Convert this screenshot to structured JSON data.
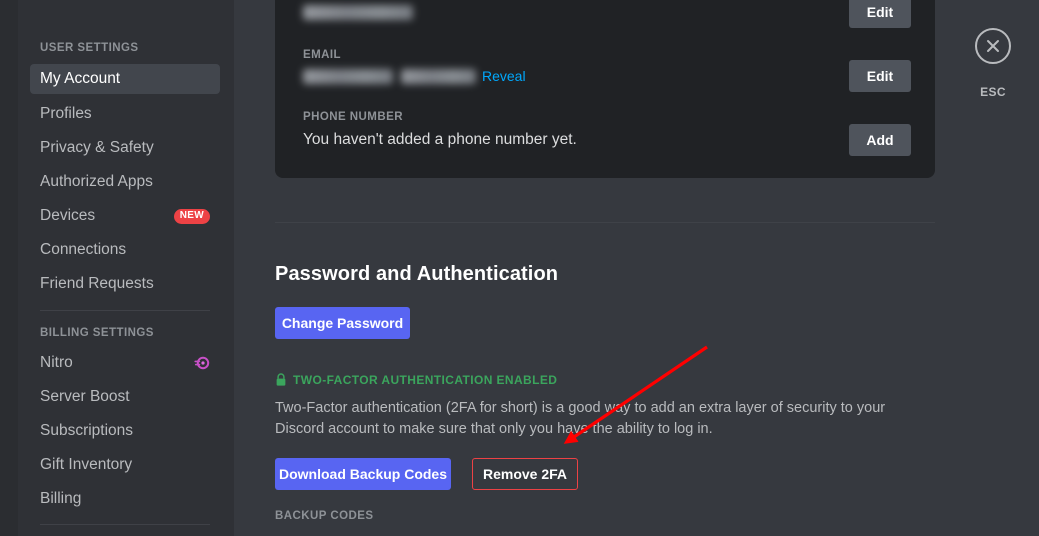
{
  "sidebar": {
    "groups": [
      {
        "header": "USER SETTINGS",
        "items": [
          {
            "label": "My Account",
            "selected": true,
            "badge": "",
            "icon": ""
          },
          {
            "label": "Profiles",
            "selected": false,
            "badge": "",
            "icon": ""
          },
          {
            "label": "Privacy & Safety",
            "selected": false,
            "badge": "",
            "icon": ""
          },
          {
            "label": "Authorized Apps",
            "selected": false,
            "badge": "",
            "icon": ""
          },
          {
            "label": "Devices",
            "selected": false,
            "badge": "NEW",
            "icon": ""
          },
          {
            "label": "Connections",
            "selected": false,
            "badge": "",
            "icon": ""
          },
          {
            "label": "Friend Requests",
            "selected": false,
            "badge": "",
            "icon": ""
          }
        ]
      },
      {
        "header": "BILLING SETTINGS",
        "items": [
          {
            "label": "Nitro",
            "selected": false,
            "badge": "",
            "icon": "nitro-wheel-icon"
          },
          {
            "label": "Server Boost",
            "selected": false,
            "badge": "",
            "icon": ""
          },
          {
            "label": "Subscriptions",
            "selected": false,
            "badge": "",
            "icon": ""
          },
          {
            "label": "Gift Inventory",
            "selected": false,
            "badge": "",
            "icon": ""
          },
          {
            "label": "Billing",
            "selected": false,
            "badge": "",
            "icon": ""
          }
        ]
      }
    ]
  },
  "account_card": {
    "username_redacted": true,
    "email": {
      "label": "EMAIL",
      "value_redacted": true,
      "reveal_label": "Reveal"
    },
    "phone": {
      "label": "PHONE NUMBER",
      "value": "You haven't added a phone number yet."
    },
    "buttons": {
      "username_edit": "Edit",
      "email_edit": "Edit",
      "phone_add": "Add"
    }
  },
  "password_section": {
    "title": "Password and Authentication",
    "change_password_label": "Change Password",
    "twofa_status": "TWO-FACTOR AUTHENTICATION ENABLED",
    "twofa_description": "Two-Factor authentication (2FA for short) is a good way to add an extra layer of security to your Discord account to make sure that only you have the ability to log in.",
    "download_codes_label": "Download Backup Codes",
    "remove_2fa_label": "Remove 2FA",
    "backup_codes_label": "BACKUP CODES"
  },
  "close_button": {
    "label": "ESC",
    "icon": "close-x-icon"
  },
  "annotation": {
    "type": "arrow",
    "color": "#ff0000",
    "points_to": "Remove 2FA"
  },
  "colors": {
    "accent_blurple": "#5865f2",
    "danger_red": "#ed4245",
    "success_green": "#3ba55d",
    "link_blue": "#00a8fc",
    "sidebar_bg": "#2f3136",
    "content_bg": "#36393f",
    "card_bg": "#202225",
    "grey_button": "#4f545c"
  }
}
